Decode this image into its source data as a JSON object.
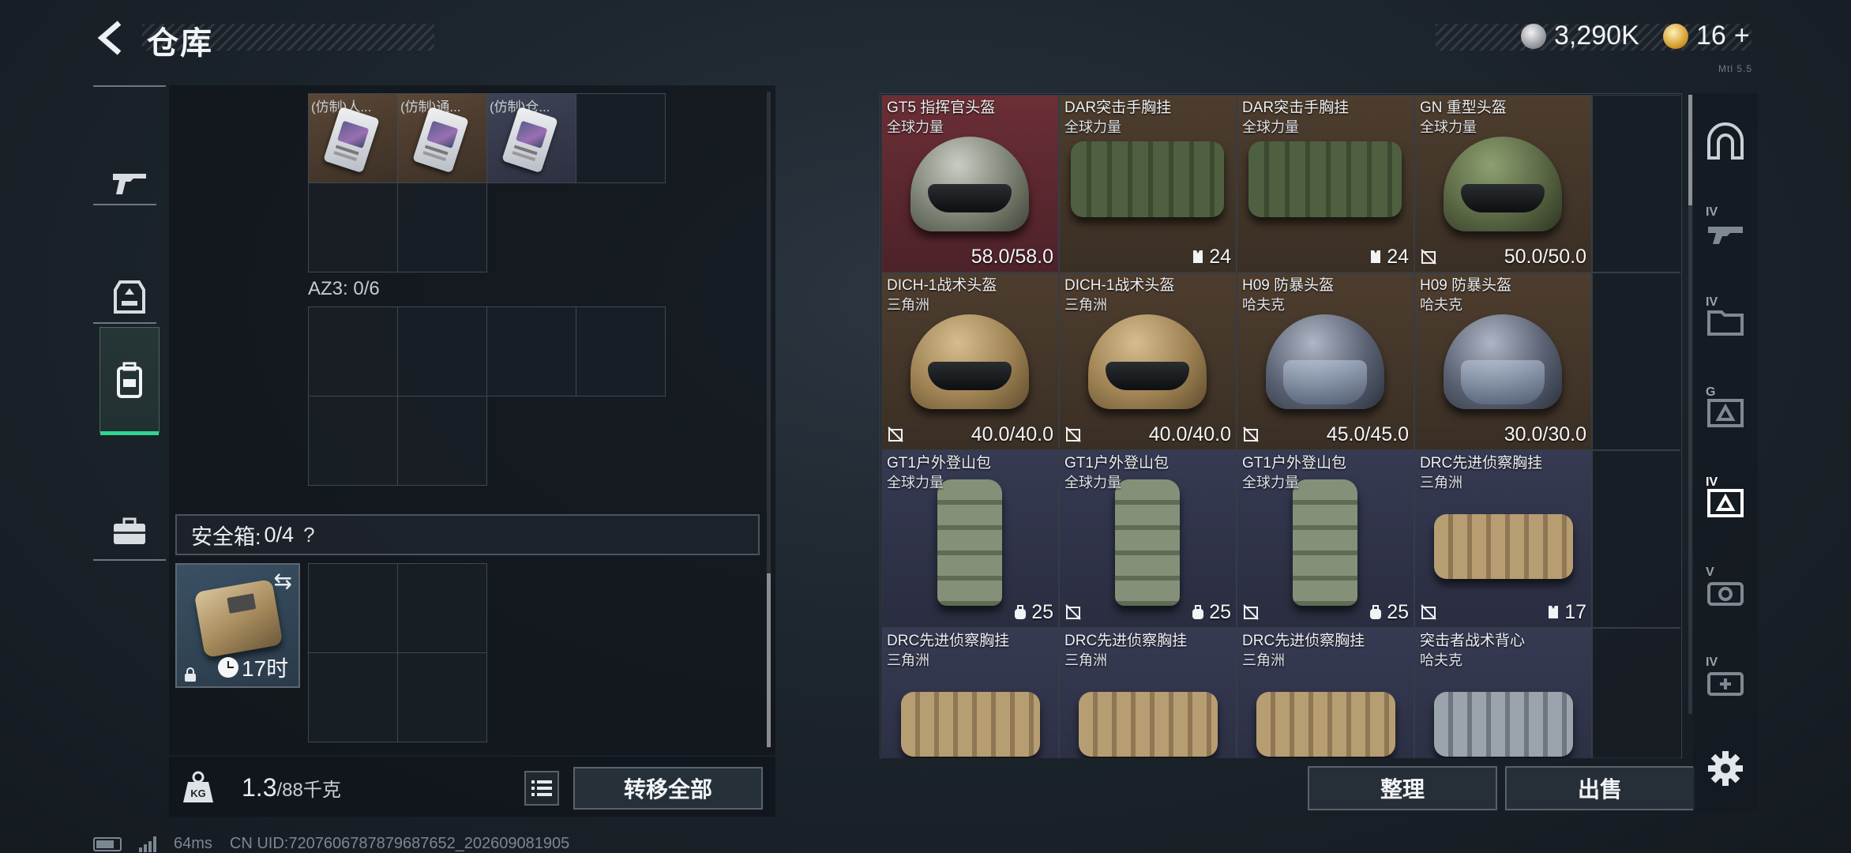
{
  "header": {
    "title": "仓库",
    "silver_amount": "3,290K",
    "gold_amount": "16",
    "gold_plus": "+",
    "corner_note": "Mtl 5.5"
  },
  "left_tabs": [
    {
      "name": "weapon",
      "icon": "gun-icon"
    },
    {
      "name": "equipment",
      "icon": "armor-icon"
    },
    {
      "name": "container",
      "icon": "backpack-icon",
      "active": true
    },
    {
      "name": "case",
      "icon": "briefcase-icon"
    }
  ],
  "left_panel": {
    "top_items": [
      {
        "label": "(仿制)人..."
      },
      {
        "label": "(仿制)通..."
      },
      {
        "label": "(仿制)仓..."
      }
    ],
    "az3_label": "AZ3: 0/6",
    "safebox": {
      "label": "安全箱:",
      "count": "0/4",
      "help": "?",
      "timer": "17时"
    }
  },
  "weight": {
    "current": "1.3",
    "max": "/88千克"
  },
  "buttons": {
    "transfer_all": "转移全部",
    "sort": "整理",
    "sell": "出售"
  },
  "warehouse": {
    "items": [
      {
        "name": "GT5 指挥官头盔",
        "sub": "全球力量",
        "value": "58.0/58.0",
        "rarity": "red",
        "art": "helmet-green",
        "nolink": false,
        "icon": ""
      },
      {
        "name": "DAR突击手胸挂",
        "sub": "全球力量",
        "value": "24",
        "rarity": "brown",
        "art": "vest-green",
        "nolink": false,
        "icon": "vest-capacity-icon"
      },
      {
        "name": "DAR突击手胸挂",
        "sub": "全球力量",
        "value": "24",
        "rarity": "brown",
        "art": "vest-green",
        "nolink": false,
        "icon": "vest-capacity-icon"
      },
      {
        "name": "GN 重型头盔",
        "sub": "全球力量",
        "value": "50.0/50.0",
        "rarity": "brown",
        "art": "helmet-olive",
        "nolink": true,
        "icon": ""
      },
      {
        "name": "DICH-1战术头盔",
        "sub": "三角洲",
        "value": "40.0/40.0",
        "rarity": "brown",
        "art": "helmet-tan",
        "nolink": true,
        "icon": ""
      },
      {
        "name": "DICH-1战术头盔",
        "sub": "三角洲",
        "value": "40.0/40.0",
        "rarity": "brown",
        "art": "helmet-tan",
        "nolink": true,
        "icon": ""
      },
      {
        "name": "H09 防暴头盔",
        "sub": "哈夫克",
        "value": "45.0/45.0",
        "rarity": "brown",
        "art": "helmet-steel",
        "nolink": true,
        "icon": ""
      },
      {
        "name": "H09 防暴头盔",
        "sub": "哈夫克",
        "value": "30.0/30.0",
        "rarity": "brown",
        "art": "helmet-steel",
        "nolink": false,
        "icon": ""
      },
      {
        "name": "GT1户外登山包",
        "sub": "全球力量",
        "value": "25",
        "rarity": "blue",
        "art": "backpack",
        "nolink": false,
        "icon": "backpack-capacity-icon"
      },
      {
        "name": "GT1户外登山包",
        "sub": "全球力量",
        "value": "25",
        "rarity": "blue",
        "art": "backpack",
        "nolink": true,
        "icon": "backpack-capacity-icon"
      },
      {
        "name": "GT1户外登山包",
        "sub": "全球力量",
        "value": "25",
        "rarity": "blue",
        "art": "backpack",
        "nolink": true,
        "icon": "backpack-capacity-icon"
      },
      {
        "name": "DRC先进侦察胸挂",
        "sub": "三角洲",
        "value": "17",
        "rarity": "blue",
        "art": "vest-tan",
        "nolink": true,
        "icon": "vest-capacity-icon"
      },
      {
        "name": "DRC先进侦察胸挂",
        "sub": "三角洲",
        "value": "",
        "rarity": "blue",
        "art": "vest-tan",
        "nolink": false,
        "icon": ""
      },
      {
        "name": "DRC先进侦察胸挂",
        "sub": "三角洲",
        "value": "",
        "rarity": "blue",
        "art": "vest-tan",
        "nolink": false,
        "icon": ""
      },
      {
        "name": "DRC先进侦察胸挂",
        "sub": "三角洲",
        "value": "",
        "rarity": "blue",
        "art": "vest-tan",
        "nolink": false,
        "icon": ""
      },
      {
        "name": "突击者战术背心",
        "sub": "哈夫克",
        "value": "",
        "rarity": "blue",
        "art": "vest-grey",
        "nolink": false,
        "icon": ""
      }
    ]
  },
  "right_tabs": [
    {
      "name": "all",
      "level": ""
    },
    {
      "name": "helmet",
      "level": "IV"
    },
    {
      "name": "armor",
      "level": "IV"
    },
    {
      "name": "chest-rig",
      "level": "G"
    },
    {
      "name": "backpack",
      "level": "IV",
      "active": true
    },
    {
      "name": "key",
      "level": "V"
    },
    {
      "name": "medical",
      "level": "IV"
    }
  ],
  "status": {
    "ping": "64ms",
    "uid": "CN UID:7207606787879687652_202609081905"
  },
  "colors": {
    "accent": "#2fd68e",
    "rarity_red": "#6b2e35",
    "rarity_brown": "#4d3d2e",
    "rarity_blue": "#363a52"
  }
}
